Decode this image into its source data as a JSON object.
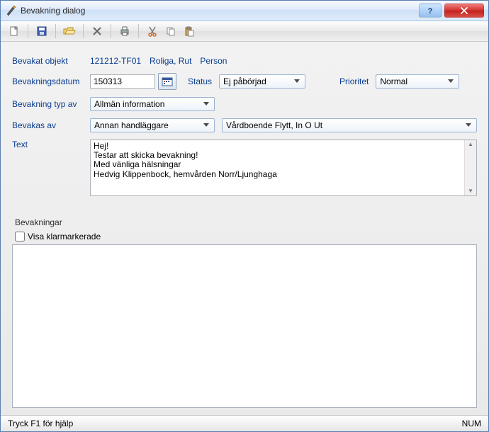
{
  "window": {
    "title": "Bevakning dialog"
  },
  "toolbar": {
    "new": "new",
    "save": "save",
    "open": "open",
    "delete": "delete",
    "print": "print",
    "cut": "cut",
    "copy": "copy",
    "paste": "paste"
  },
  "labels": {
    "object": "Bevakat objekt",
    "date": "Bevakningsdatum",
    "status": "Status",
    "priority": "Prioritet",
    "type": "Bevakning typ av",
    "by": "Bevakas av",
    "text": "Text",
    "section": "Bevakningar",
    "show_done": "Visa klarmarkerade"
  },
  "values": {
    "object_id": "121212-TF01",
    "object_name": "Roliga, Rut",
    "object_kind": "Person",
    "date": "150313",
    "status": "Ej påbörjad",
    "priority": "Normal",
    "type": "Allmän information",
    "handler": "Annan handläggare",
    "org": "Vårdboende Flytt, In O Ut",
    "text": "Hej!\nTestar att skicka bevakning!\nMed vänliga hälsningar\nHedvig Klippenbock, hemvården Norr/Ljunghaga",
    "show_done": false
  },
  "statusbar": {
    "hint": "Tryck F1 för hjälp",
    "num": "NUM"
  }
}
